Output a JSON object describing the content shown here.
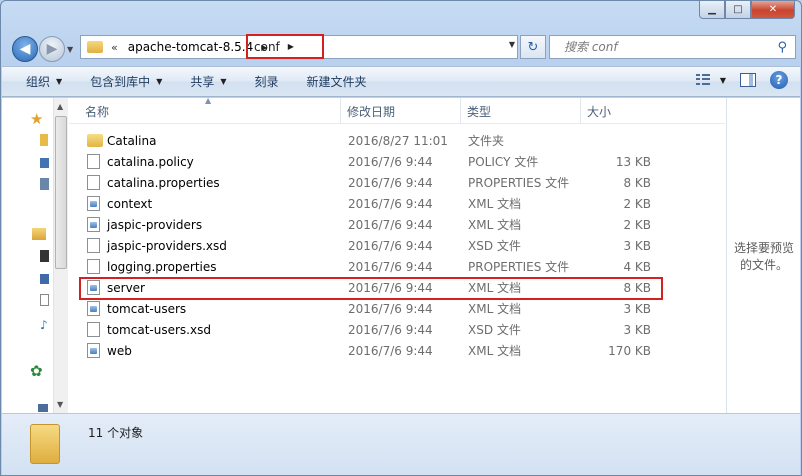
{
  "window": {
    "controls": {
      "minimize": "▁",
      "maximize": "□",
      "close": "✕"
    }
  },
  "address": {
    "chevron": "«",
    "segments": [
      "apache-tomcat-8.5.4"
    ],
    "current": "conf",
    "search_placeholder": "搜索 conf"
  },
  "toolbar": {
    "organize": "组织",
    "include_in_library": "包含到库中",
    "share": "共享",
    "burn": "刻录",
    "new_folder": "新建文件夹"
  },
  "columns": {
    "name": "名称",
    "date": "修改日期",
    "type": "类型",
    "size": "大小"
  },
  "files": [
    {
      "name": "Catalina",
      "date": "2016/8/27 11:01",
      "type": "文件夹",
      "size": "",
      "icon": "folder-icon"
    },
    {
      "name": "catalina.policy",
      "date": "2016/7/6 9:44",
      "type": "POLICY 文件",
      "size": "13 KB",
      "icon": "file-icon"
    },
    {
      "name": "catalina.properties",
      "date": "2016/7/6 9:44",
      "type": "PROPERTIES 文件",
      "size": "8 KB",
      "icon": "file-icon"
    },
    {
      "name": "context",
      "date": "2016/7/6 9:44",
      "type": "XML 文档",
      "size": "2 KB",
      "icon": "xml-file-icon"
    },
    {
      "name": "jaspic-providers",
      "date": "2016/7/6 9:44",
      "type": "XML 文档",
      "size": "2 KB",
      "icon": "xml-file-icon"
    },
    {
      "name": "jaspic-providers.xsd",
      "date": "2016/7/6 9:44",
      "type": "XSD 文件",
      "size": "3 KB",
      "icon": "file-icon"
    },
    {
      "name": "logging.properties",
      "date": "2016/7/6 9:44",
      "type": "PROPERTIES 文件",
      "size": "4 KB",
      "icon": "file-icon"
    },
    {
      "name": "server",
      "date": "2016/7/6 9:44",
      "type": "XML 文档",
      "size": "8 KB",
      "icon": "xml-file-icon"
    },
    {
      "name": "tomcat-users",
      "date": "2016/7/6 9:44",
      "type": "XML 文档",
      "size": "3 KB",
      "icon": "xml-file-icon"
    },
    {
      "name": "tomcat-users.xsd",
      "date": "2016/7/6 9:44",
      "type": "XSD 文件",
      "size": "3 KB",
      "icon": "file-icon"
    },
    {
      "name": "web",
      "date": "2016/7/6 9:44",
      "type": "XML 文档",
      "size": "170 KB",
      "icon": "xml-file-icon"
    }
  ],
  "preview": {
    "text": "选择要预览的文件。"
  },
  "status": {
    "count": "11 个对象"
  },
  "colors": {
    "highlight": "#d32020",
    "accent": "#2a5fa6"
  }
}
